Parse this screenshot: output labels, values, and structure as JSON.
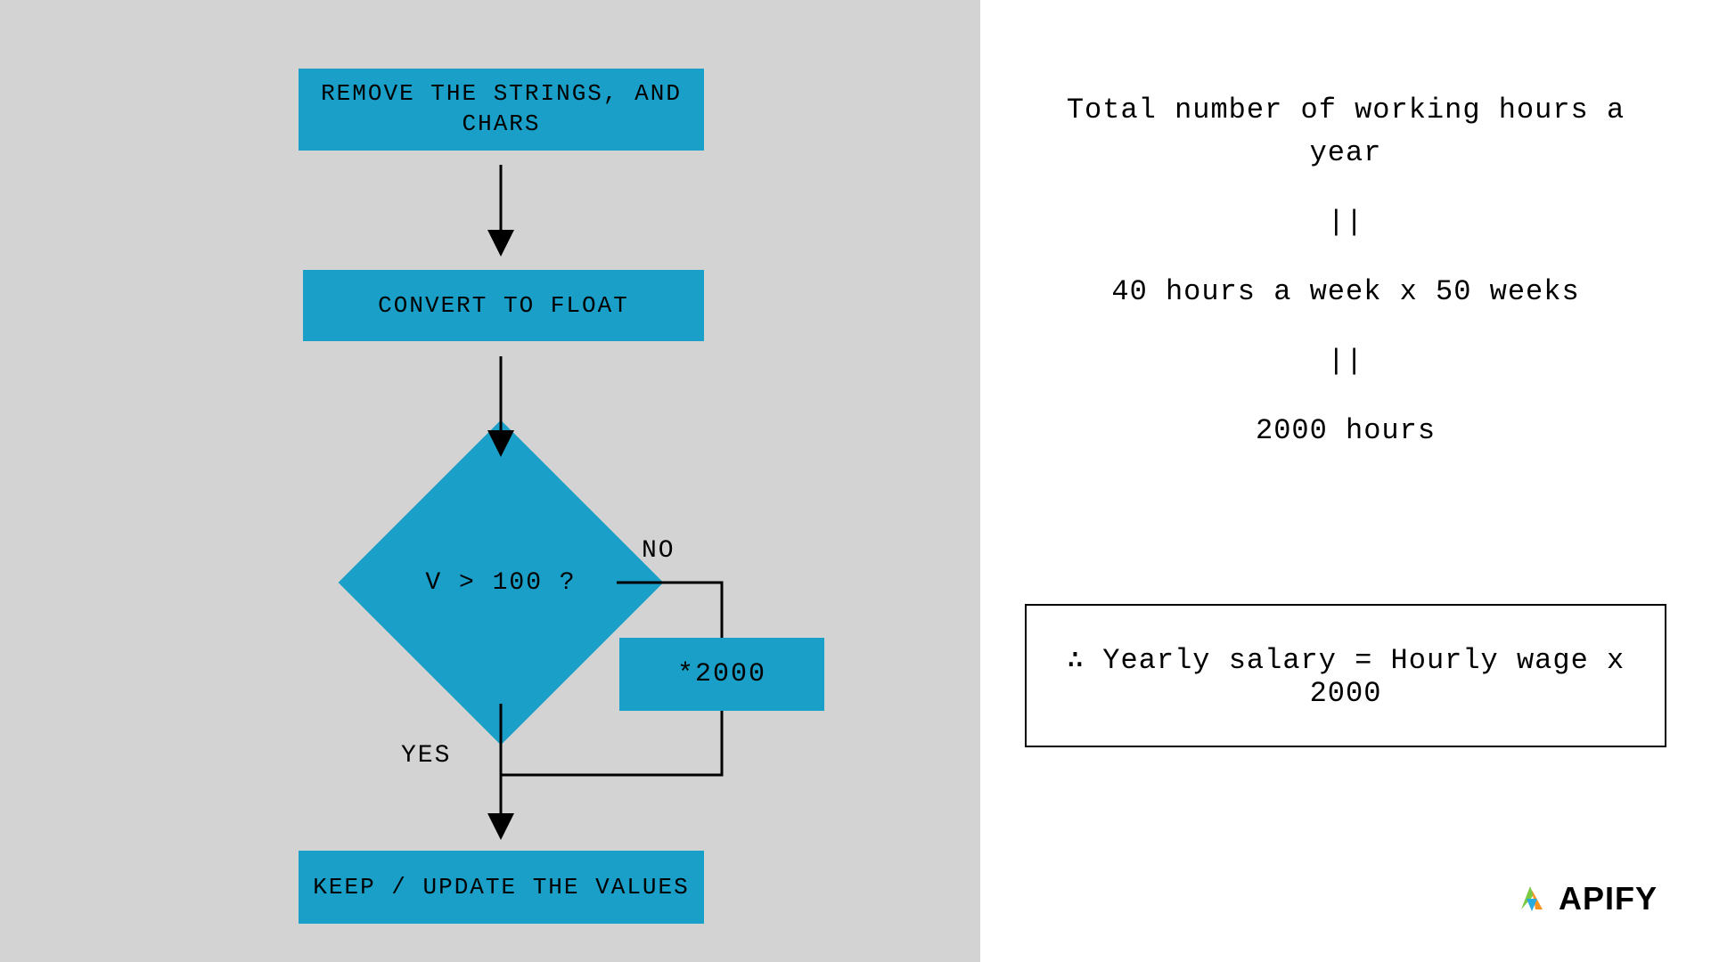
{
  "flowchart": {
    "box1": "REMOVE THE STRINGS, AND CHARS",
    "box2": "CONVERT TO FLOAT",
    "decision": "V > 100 ?",
    "box4": "*2000",
    "box5": "KEEP / UPDATE THE VALUES",
    "label_no": "NO",
    "label_yes": "YES"
  },
  "right": {
    "line1": "Total number of working hours a year",
    "sep": "||",
    "line2": "40 hours a week x 50 weeks",
    "line3": "2000 hours",
    "formula": "∴ Yearly salary = Hourly wage x 2000"
  },
  "logo": {
    "text": "APIFY"
  }
}
